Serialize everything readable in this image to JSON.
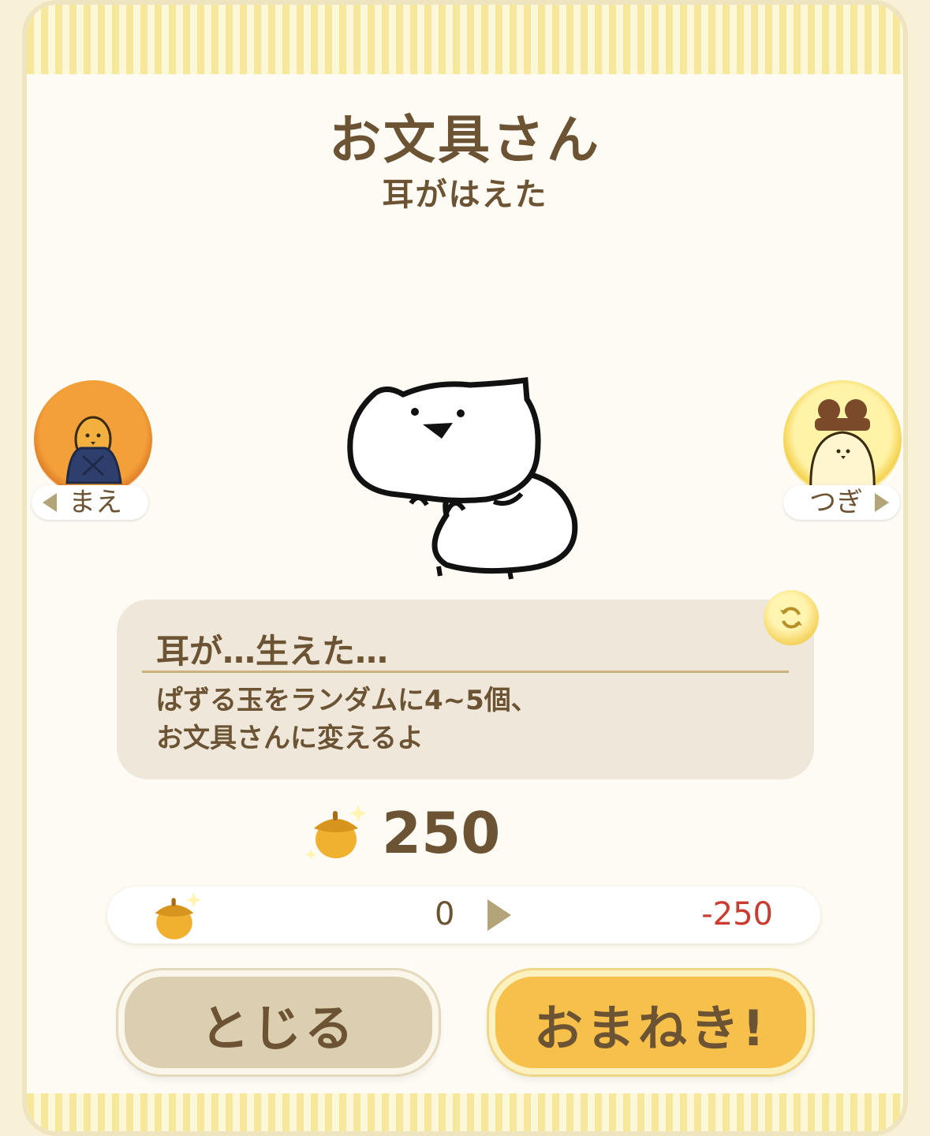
{
  "header": {
    "title": "お文具さん",
    "subtitle": "耳がはえた"
  },
  "nav": {
    "prev_label": "まえ",
    "next_label": "つぎ"
  },
  "skill": {
    "name": "耳が…生えた…",
    "description_lines": [
      "ぱずる玉をランダムに4~5個、",
      "お文具さんに変えるよ"
    ]
  },
  "cost": {
    "value": "250"
  },
  "balance": {
    "current": "0",
    "after": "-250"
  },
  "buttons": {
    "close_label": "とじる",
    "invite_label": "おまねき!"
  },
  "colors": {
    "text_brown": "#6b5333",
    "negative_red": "#cc3b30",
    "invite_gold": "#f6c04a",
    "close_beige": "#dcceb0"
  }
}
